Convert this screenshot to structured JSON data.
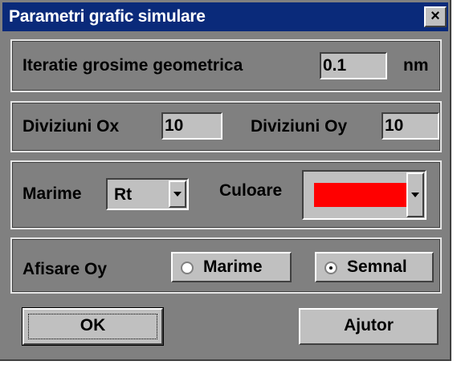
{
  "window": {
    "title": "Parametri grafic simulare",
    "close_glyph": "×"
  },
  "iteration": {
    "label": "Iteratie grosime geometrica",
    "value": "0.1",
    "unit": "nm"
  },
  "divisions": {
    "ox_label": "Diviziuni Ox",
    "ox_value": "10",
    "oy_label": "Diviziuni Oy",
    "oy_value": "10"
  },
  "size": {
    "label": "Marime",
    "selected": "Rt"
  },
  "color": {
    "label": "Culoare",
    "selected_color": "#ff0000"
  },
  "display_oy": {
    "label": "Afisare Oy",
    "options": [
      {
        "label": "Marime",
        "selected": false
      },
      {
        "label": "Semnal",
        "selected": true
      }
    ]
  },
  "buttons": {
    "ok": "OK",
    "help": "Ajutor"
  }
}
